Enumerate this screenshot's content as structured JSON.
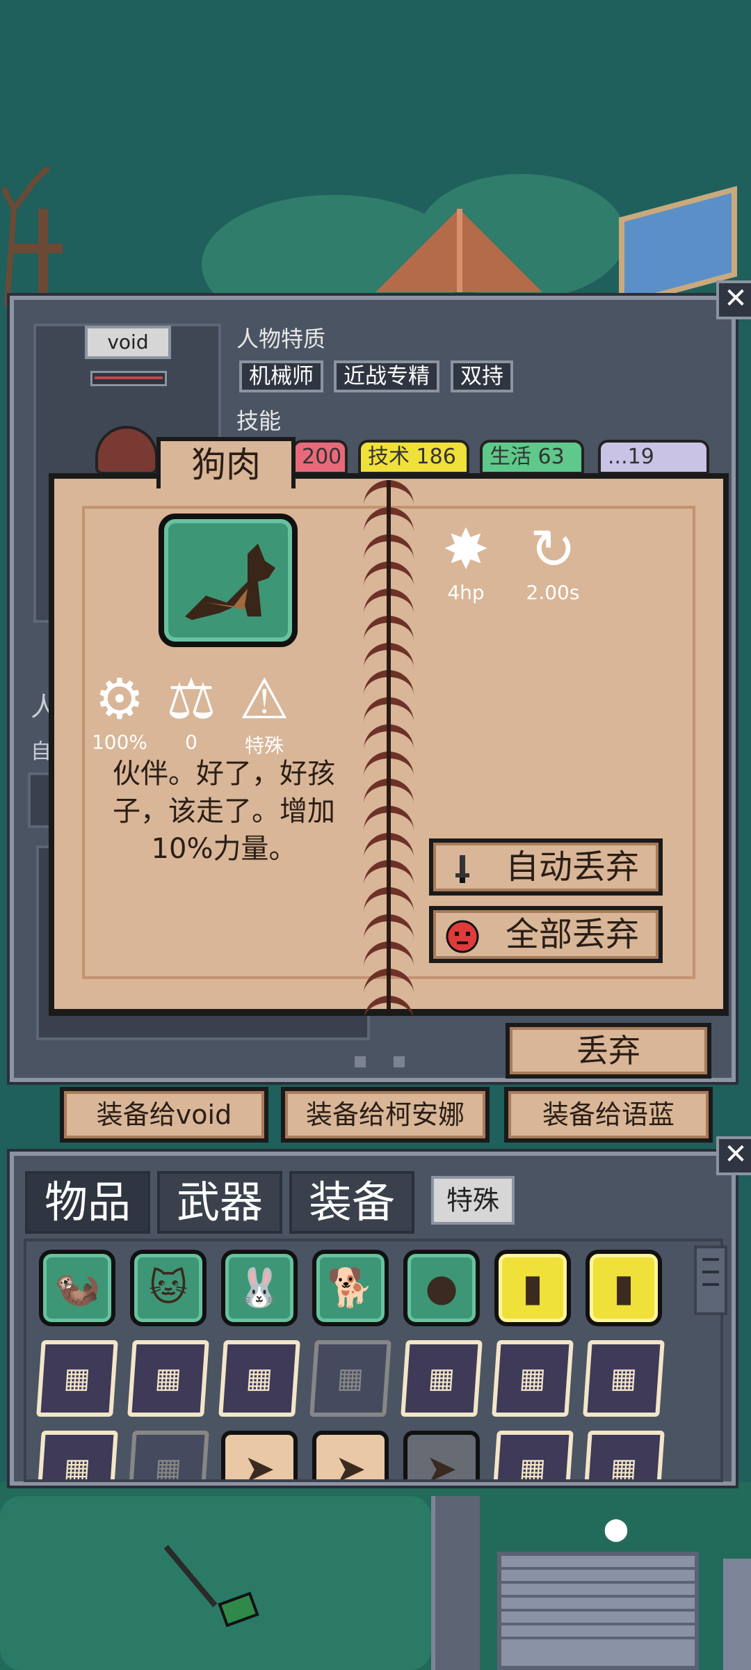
{
  "character": {
    "name": "void",
    "traits_label": "人物特质",
    "traits": [
      "机械师",
      "近战专精",
      "双持"
    ],
    "skills_label": "技能",
    "skills": [
      {
        "label": "200",
        "color": "#e86a7a"
      },
      {
        "label": "技术 186",
        "color": "#f0e03a"
      },
      {
        "label": "生活 63",
        "color": "#5ec98a"
      },
      {
        "label": "...19",
        "color": "#c9c3e6"
      }
    ],
    "side_stub_1": "人",
    "side_stub_2": "自"
  },
  "item": {
    "name": "狗肉",
    "icon": "dog-icon",
    "stats": {
      "damage": "4hp",
      "cooldown": "2.00s",
      "durability": "100%",
      "weight": "0",
      "type": "特殊"
    },
    "description": "伙伴。好了，好孩子，该走了。增加10%力量。",
    "auto_discard_label": "自动丢弃",
    "discard_all_label": "全部丢弃"
  },
  "actions": {
    "discard_label": "丢弃",
    "equip_buttons": [
      "装备给void",
      "装备给柯安娜",
      "装备给语蓝"
    ]
  },
  "inventory": {
    "tabs": [
      "物品",
      "武器",
      "装备"
    ],
    "special_tab": "特殊",
    "rows": [
      [
        {
          "kind": "green",
          "icon": "weasel-icon"
        },
        {
          "kind": "green",
          "icon": "cat-icon"
        },
        {
          "kind": "green",
          "icon": "rabbit-icon"
        },
        {
          "kind": "green",
          "icon": "dog-icon"
        },
        {
          "kind": "green",
          "icon": "slime-icon"
        },
        {
          "kind": "yellow",
          "icon": "canister-icon"
        },
        {
          "kind": "yellow",
          "icon": "canister-icon"
        }
      ],
      [
        {
          "kind": "chip",
          "icon": "circuit-chip-icon"
        },
        {
          "kind": "chip",
          "icon": "circuit-chip-icon"
        },
        {
          "kind": "chip",
          "icon": "circuit-chip-icon"
        },
        {
          "kind": "chip-faded",
          "icon": "circuit-chip-icon"
        },
        {
          "kind": "chip",
          "icon": "circuit-chip-icon"
        },
        {
          "kind": "chip",
          "icon": "circuit-chip-icon"
        },
        {
          "kind": "chip",
          "icon": "circuit-chip-icon"
        }
      ],
      [
        {
          "kind": "chip",
          "icon": "circuit-chip-icon"
        },
        {
          "kind": "chip-faded",
          "icon": "circuit-chip-icon"
        },
        {
          "kind": "spear",
          "icon": "spearhead-icon"
        },
        {
          "kind": "spear",
          "icon": "spearhead-icon"
        },
        {
          "kind": "spear-faded",
          "icon": "spearhead-icon"
        },
        {
          "kind": "chip",
          "icon": "circuit-chip-icon"
        },
        {
          "kind": "chip",
          "icon": "circuit-chip-icon"
        }
      ]
    ]
  },
  "colors": {
    "parchment": "#d8b697",
    "panel": "#4b5463",
    "item_green": "#3d9776",
    "item_yellow": "#f0e03a"
  }
}
